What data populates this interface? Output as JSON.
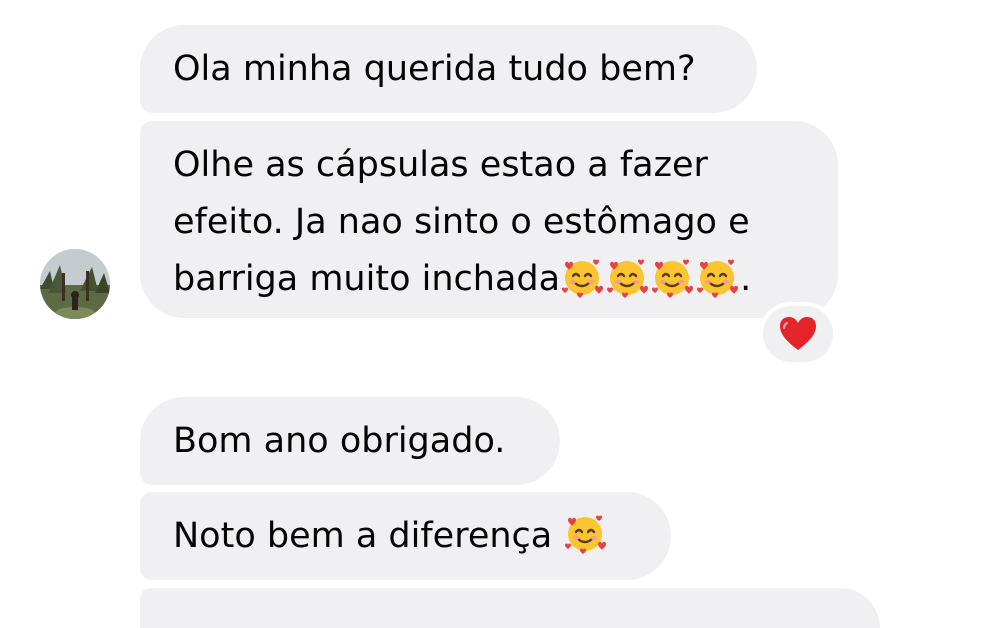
{
  "conversation": {
    "messages": [
      {
        "lines": [
          "Ola minha querida tudo bem?"
        ]
      },
      {
        "lines": [
          "Olhe as cápsulas estao a fazer",
          "efeito. Ja nao sinto o estômago e",
          "barriga muito inchada"
        ],
        "trailing_emojis": [
          "smiling-face-with-hearts",
          "smiling-face-with-hearts",
          "smiling-face-with-hearts",
          "smiling-face-with-hearts"
        ],
        "trailing_text": ".",
        "reaction": "red-heart"
      },
      {
        "lines": [
          "Bom ano obrigado."
        ]
      },
      {
        "lines": [
          "Noto bem a diferença "
        ],
        "trailing_emojis": [
          "smiling-face-with-hearts"
        ]
      }
    ]
  },
  "colors": {
    "bubble_background": "#f0f0f2",
    "text": "#050505",
    "reaction_heart": "#e3242b"
  }
}
